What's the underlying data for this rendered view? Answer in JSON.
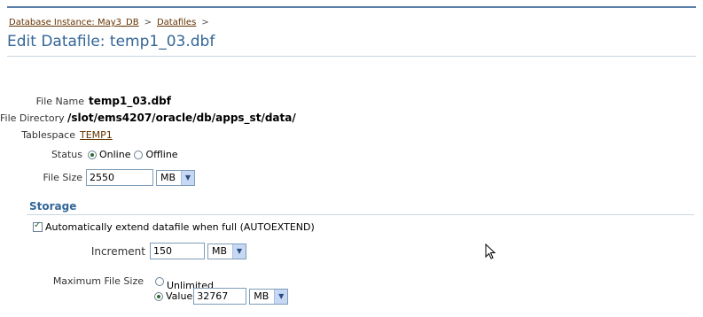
{
  "breadcrumb": {
    "items": [
      "Database Instance: May3_DB",
      "Datafiles"
    ],
    "separator": ">"
  },
  "page_title": "Edit Datafile: temp1_03.dbf",
  "file_name": {
    "label": "File Name",
    "value": "temp1_03.dbf"
  },
  "file_directory": {
    "label": "File Directory",
    "value": "/slot/ems4207/oracle/db/apps_st/data/"
  },
  "tablespace": {
    "label": "Tablespace",
    "value": "TEMP1"
  },
  "status": {
    "label": "Status",
    "options": [
      "Online",
      "Offline"
    ],
    "selected": "Online"
  },
  "file_size": {
    "label": "File Size",
    "value": "2550",
    "unit": "MB"
  },
  "storage": {
    "heading": "Storage",
    "autoextend_label": "Automatically extend datafile when full (AUTOEXTEND)",
    "autoextend_checked": true,
    "increment": {
      "label": "Increment",
      "value": "150",
      "unit": "MB"
    },
    "max_file_size": {
      "label": "Maximum File Size",
      "unlimited_label": "Unlimited",
      "value_label": "Value",
      "selected": "Value",
      "value": "32767",
      "unit": "MB"
    }
  },
  "icons": {
    "dropdown": "chevron-down-icon",
    "cursor": "mouse-pointer-icon"
  },
  "colors": {
    "header_blue": "#336699",
    "link_brown": "#663300"
  }
}
